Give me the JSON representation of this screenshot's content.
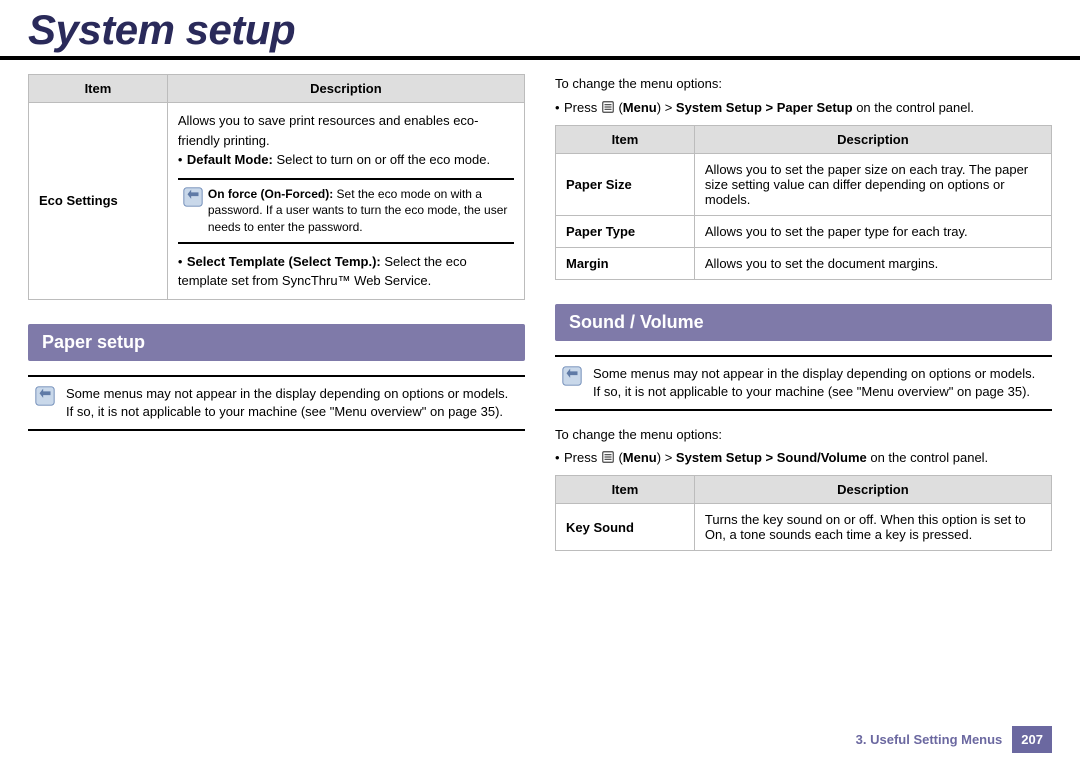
{
  "page_title": "System setup",
  "eco_table": {
    "headers": {
      "item": "Item",
      "desc": "Description"
    },
    "item": "Eco Settings",
    "line1": "Allows you to save print resources and enables eco-friendly printing.",
    "bullet1_label": "Default Mode:",
    "bullet1_rest": " Select to turn on or off the eco mode.",
    "note_label": "On force (On-Forced):",
    "note_rest": " Set the eco mode on with a password. If a user wants to turn the eco mode, the user needs to enter the password.",
    "bullet2_label": "Select Template (Select Temp.):",
    "bullet2_rest": " Select the eco template set from SyncThru™ Web Service."
  },
  "section_paper": "Paper setup",
  "paper_note": "Some menus may not appear in the display depending on options or models. If so, it is not applicable to your machine (see \"Menu overview\" on page 35).",
  "right_intro": "To change the menu options:",
  "paper_path_prefix": "Press ",
  "paper_path_menu": "Menu",
  "paper_path_rest1": " > ",
  "paper_path_bold": "System Setup > Paper Setup",
  "paper_path_end": " on the control panel.",
  "paper_table": {
    "headers": {
      "item": "Item",
      "desc": "Description"
    },
    "rows": [
      {
        "item": "Paper Size",
        "desc": "Allows you to set the paper size on each tray. The paper size setting value can differ depending on options or models."
      },
      {
        "item": "Paper Type",
        "desc": "Allows you to set the paper type for each tray."
      },
      {
        "item": "Margin",
        "desc": "Allows you to set the document margins."
      }
    ]
  },
  "section_sound": "Sound / Volume",
  "sound_note": "Some menus may not appear in the display depending on options or models. If so, it is not applicable to your machine (see \"Menu overview\" on page 35).",
  "sound_intro": "To change the menu options:",
  "sound_path_prefix": "Press ",
  "sound_path_menu": "Menu",
  "sound_path_rest1": " > ",
  "sound_path_bold": "System Setup > Sound/Volume",
  "sound_path_end": " on the control panel.",
  "sound_table": {
    "headers": {
      "item": "Item",
      "desc": "Description"
    },
    "rows": [
      {
        "item": "Key Sound",
        "desc": "Turns the key sound on or off. When this option is set to On, a tone sounds each time a key is pressed."
      }
    ]
  },
  "footer": {
    "chapter": "3.  Useful Setting Menus",
    "page": "207"
  },
  "icons": {
    "note": "note-icon",
    "menu": "menu-icon"
  }
}
